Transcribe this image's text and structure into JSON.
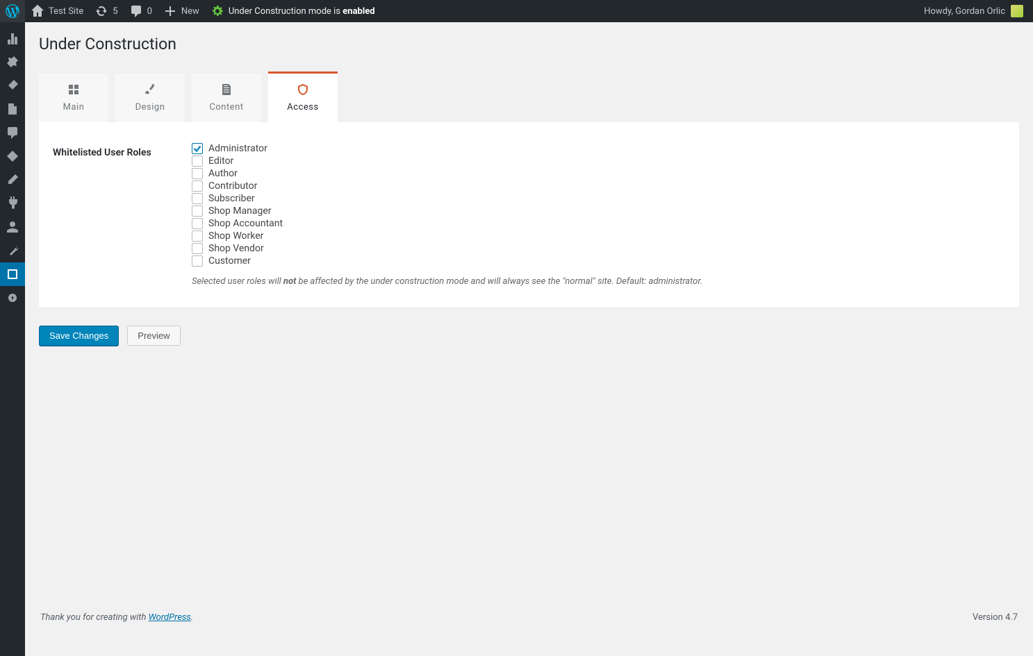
{
  "admin_bar": {
    "site_name": "Test Site",
    "updates_count": "5",
    "comments_count": "0",
    "new_label": "New",
    "uc_mode_prefix": "Under Construction mode is ",
    "uc_mode_state": "enabled",
    "greeting_prefix": "Howdy, ",
    "user_name": "Gordan Orlic"
  },
  "page": {
    "title": "Under Construction"
  },
  "tabs": [
    {
      "id": "main",
      "label": "Main",
      "active": false
    },
    {
      "id": "design",
      "label": "Design",
      "active": false
    },
    {
      "id": "content",
      "label": "Content",
      "active": false
    },
    {
      "id": "access",
      "label": "Access",
      "active": true
    }
  ],
  "form": {
    "section_label": "Whitelisted User Roles",
    "roles": [
      {
        "key": "administrator",
        "label": "Administrator",
        "checked": true
      },
      {
        "key": "editor",
        "label": "Editor",
        "checked": false
      },
      {
        "key": "author",
        "label": "Author",
        "checked": false
      },
      {
        "key": "contributor",
        "label": "Contributor",
        "checked": false
      },
      {
        "key": "subscriber",
        "label": "Subscriber",
        "checked": false
      },
      {
        "key": "shop_manager",
        "label": "Shop Manager",
        "checked": false
      },
      {
        "key": "shop_accountant",
        "label": "Shop Accountant",
        "checked": false
      },
      {
        "key": "shop_worker",
        "label": "Shop Worker",
        "checked": false
      },
      {
        "key": "shop_vendor",
        "label": "Shop Vendor",
        "checked": false
      },
      {
        "key": "customer",
        "label": "Customer",
        "checked": false
      }
    ],
    "description_pre": "Selected user roles will ",
    "description_bold": "not",
    "description_post": " be affected by the under construction mode and will always see the \"normal\" site. Default: administrator."
  },
  "buttons": {
    "save": "Save Changes",
    "preview": "Preview"
  },
  "footer": {
    "thank_pre": "Thank you for creating with ",
    "wp_link": "WordPress",
    "thank_post": ".",
    "version_label": "Version 4.7"
  }
}
